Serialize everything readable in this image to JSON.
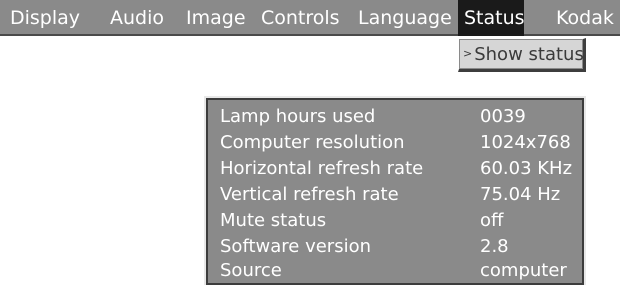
{
  "menubar": {
    "items": [
      {
        "label": "Display"
      },
      {
        "label": "Audio"
      },
      {
        "label": "Image"
      },
      {
        "label": "Controls"
      },
      {
        "label": "Language"
      },
      {
        "label": "Status",
        "active": true
      },
      {
        "label": "Kodak"
      }
    ]
  },
  "submenu": {
    "items": [
      {
        "label": "Show status",
        "chevron": ">"
      }
    ]
  },
  "status_panel": {
    "rows": [
      {
        "label": "Lamp hours used",
        "value": "0039"
      },
      {
        "label": "Computer resolution",
        "value": "1024x768"
      },
      {
        "label": "Horizontal refresh rate",
        "value": "60.03 KHz"
      },
      {
        "label": "Vertical refresh rate",
        "value": "75.04 Hz"
      },
      {
        "label": "Mute status",
        "value": "off"
      },
      {
        "label": "Software version",
        "value": "2.8"
      },
      {
        "label": "Source",
        "value": "computer"
      }
    ]
  },
  "colors": {
    "menubar_bg": "#8a8a8a",
    "active_tab_bg": "#1a1a1a",
    "submenu_bg": "#d6d6d6",
    "panel_bg": "#8a8a8a",
    "text_light": "#ffffff",
    "text_dark": "#3a3a3a"
  }
}
